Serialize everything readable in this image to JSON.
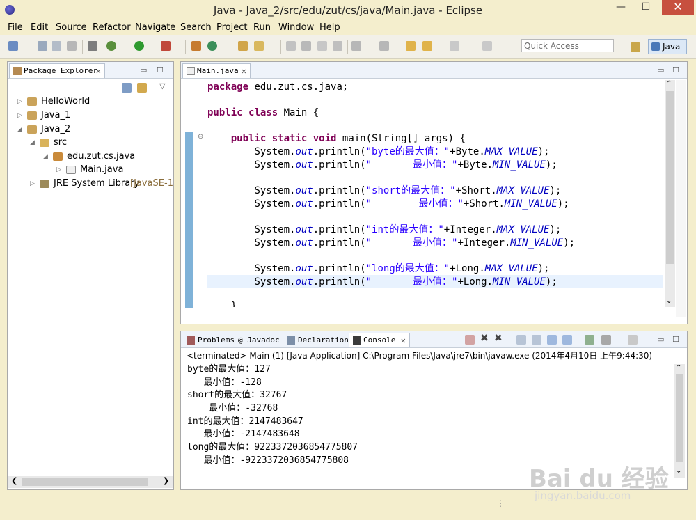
{
  "window": {
    "title": "Java - Java_2/src/edu/zut/cs/java/Main.java - Eclipse",
    "minimize": "—",
    "maximize": "☐",
    "close": "✕"
  },
  "menu": [
    "File",
    "Edit",
    "Source",
    "Refactor",
    "Navigate",
    "Search",
    "Project",
    "Run",
    "Window",
    "Help"
  ],
  "toolbar": {
    "quick_access_placeholder": "Quick Access",
    "perspective": "Java"
  },
  "package_explorer": {
    "tab": "Package Explorer",
    "tree": [
      {
        "label": "HelloWorld"
      },
      {
        "label": "Java_1"
      },
      {
        "label": "Java_2"
      },
      {
        "label": "src"
      },
      {
        "label": "edu.zut.cs.java"
      },
      {
        "label": "Main.java"
      },
      {
        "label": "JRE System Library",
        "suffix": "[JavaSE-1"
      }
    ]
  },
  "editor": {
    "tab": "Main.java",
    "lines": {
      "l1_kw": "package",
      "l1_rest": " edu.zut.cs.java;",
      "l2_kw1": "public",
      "l2_kw2": "class",
      "l2_rest": " Main {",
      "l3_kw1": "public",
      "l3_kw2": "static",
      "l3_kw3": "void",
      "l3_rest": " main(String[] args) {",
      "sys": "System.",
      "out": "out",
      "println": ".println(",
      "s1": "\"byte的最大值：\"",
      "c1": "+Byte.",
      "f1": "MAX_VALUE",
      "e1": ");",
      "s2": "\"       最小值：\"",
      "c2": "+Byte.",
      "f2": "MIN_VALUE",
      "e2": ");",
      "s3": "\"short的最大值：\"",
      "c3": "+Short.",
      "f3": "MAX_VALUE",
      "e3": ");",
      "s4": "\"        最小值：\"",
      "c4": "+Short.",
      "f4": "MIN_VALUE",
      "e4": ");",
      "s5": "\"int的最大值：\"",
      "c5": "+Integer.",
      "f5": "MAX_VALUE",
      "e5": ");",
      "s6": "\"       最小值：\"",
      "c6": "+Integer.",
      "f6": "MIN_VALUE",
      "e6": ");",
      "s7": "\"long的最大值：\"",
      "c7": "+Long.",
      "f7": "MAX_VALUE",
      "e7": ");",
      "s8": "\"       最小值：\"",
      "c8": "+Long.",
      "f8": "MIN_VALUE",
      "e8": ");",
      "brace": "}"
    }
  },
  "bottom_tabs": [
    "Problems",
    "@ Javadoc",
    "Declaration",
    "Console"
  ],
  "console": {
    "terminated": "<terminated> Main (1) [Java Application] C:\\Program Files\\Java\\jre7\\bin\\javaw.exe (2014年4月10日 上午9:44:30)",
    "lines": [
      "byte的最大值：127",
      "   最小值：-128",
      "short的最大值：32767",
      "    最小值：-32768",
      "int的最大值：2147483647",
      "   最小值：-2147483648",
      "long的最大值：9223372036854775807",
      "   最小值：-9223372036854775808"
    ]
  },
  "watermark": {
    "main": "Bai du 经验",
    "sub": "jingyan.baidu.com"
  }
}
